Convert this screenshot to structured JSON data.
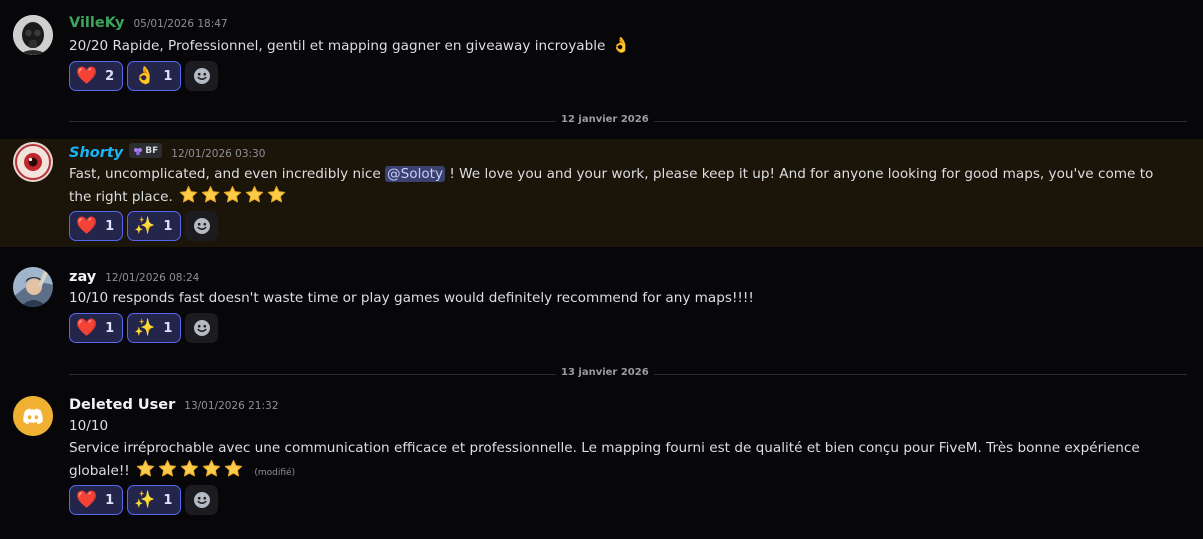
{
  "colors": {
    "background": "#070709",
    "highlight_row": "#1b1408",
    "reaction_border": "#5865f2",
    "username_villeky": "#3ba55d",
    "username_shorty": "#18b4f5",
    "username_default": "#f2f3f5",
    "mention_bg": "#3c4270"
  },
  "dividers": [
    {
      "label": "12 janvier 2026"
    },
    {
      "label": "13 janvier 2026"
    }
  ],
  "messages": [
    {
      "username": "VilleKy",
      "timestamp": "05/01/2026 18:47",
      "avatar": "gas-mask-avatar",
      "text": "20/20 Rapide, Professionnel, gentil et mapping gagner en giveaway incroyable",
      "trailing_emoji": "👌",
      "reactions": [
        {
          "emoji": "heart",
          "glyph": "❤️",
          "count": "2"
        },
        {
          "emoji": "ok-hand",
          "glyph": "👌",
          "count": "1"
        }
      ]
    },
    {
      "username": "Shorty",
      "timestamp": "12/01/2026 03:30",
      "avatar": "eye-avatar",
      "badge": {
        "icon": "grape-icon",
        "text": "BF"
      },
      "text_before_mention": "Fast, uncomplicated, and even incredibly nice",
      "mention": "@Soloty",
      "text_after_mention": "! We love you and your work, please keep it up! And for anyone looking for good maps, you've come to the right place.",
      "stars": 5,
      "reactions": [
        {
          "emoji": "heart",
          "glyph": "❤️",
          "count": "1"
        },
        {
          "emoji": "sparkles",
          "glyph": "✨",
          "count": "1"
        }
      ]
    },
    {
      "username": "zay",
      "timestamp": "12/01/2026 08:24",
      "avatar": "character-avatar",
      "text": "10/10 responds fast doesn't waste time or play games would definitely recommend for any maps!!!!",
      "reactions": [
        {
          "emoji": "heart",
          "glyph": "❤️",
          "count": "1"
        },
        {
          "emoji": "sparkles",
          "glyph": "✨",
          "count": "1"
        }
      ]
    },
    {
      "username": "Deleted User",
      "timestamp": "13/01/2026 21:32",
      "avatar": "discord-logo-avatar",
      "line1": "10/10",
      "text": "Service irréprochable avec une communication efficace et professionnelle. Le mapping fourni est de qualité et bien conçu pour FiveM. Très bonne expérience globale!!",
      "stars": 5,
      "edited": "(modifié)",
      "reactions": [
        {
          "emoji": "heart",
          "glyph": "❤️",
          "count": "1"
        },
        {
          "emoji": "sparkles",
          "glyph": "✨",
          "count": "1"
        }
      ]
    }
  ]
}
